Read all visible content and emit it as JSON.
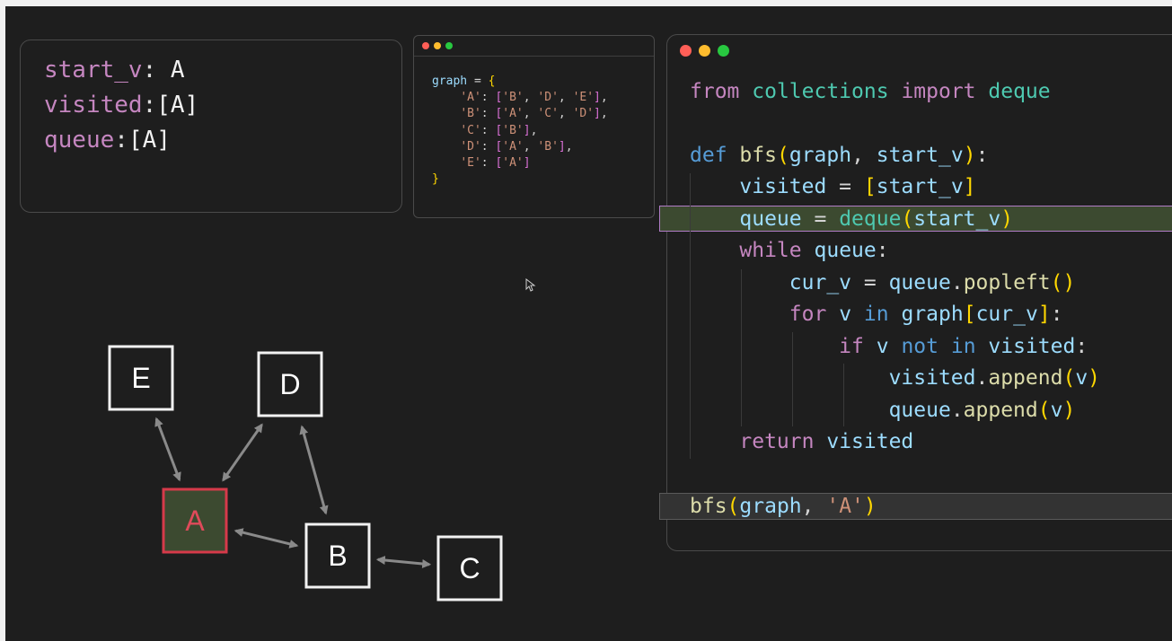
{
  "state": {
    "start_v": {
      "key": "start_v",
      "colon": ": ",
      "value": "A"
    },
    "visited": {
      "key": "visited",
      "colon": ":",
      "value": "[A]"
    },
    "queue": {
      "key": "queue",
      "colon": ":",
      "value": "[A]"
    }
  },
  "mini_code": {
    "lines": [
      [
        {
          "t": "graph",
          "c": "var"
        },
        {
          "t": " = ",
          "c": "pun"
        },
        {
          "t": "{",
          "c": "br"
        }
      ],
      [
        {
          "t": "    ",
          "c": "pun"
        },
        {
          "t": "'A'",
          "c": "str"
        },
        {
          "t": ": ",
          "c": "pun"
        },
        {
          "t": "[",
          "c": "br2"
        },
        {
          "t": "'B'",
          "c": "str"
        },
        {
          "t": ", ",
          "c": "pun"
        },
        {
          "t": "'D'",
          "c": "str"
        },
        {
          "t": ", ",
          "c": "pun"
        },
        {
          "t": "'E'",
          "c": "str"
        },
        {
          "t": "]",
          "c": "br2"
        },
        {
          "t": ",",
          "c": "pun"
        }
      ],
      [
        {
          "t": "    ",
          "c": "pun"
        },
        {
          "t": "'B'",
          "c": "str"
        },
        {
          "t": ": ",
          "c": "pun"
        },
        {
          "t": "[",
          "c": "br2"
        },
        {
          "t": "'A'",
          "c": "str"
        },
        {
          "t": ", ",
          "c": "pun"
        },
        {
          "t": "'C'",
          "c": "str"
        },
        {
          "t": ", ",
          "c": "pun"
        },
        {
          "t": "'D'",
          "c": "str"
        },
        {
          "t": "]",
          "c": "br2"
        },
        {
          "t": ",",
          "c": "pun"
        }
      ],
      [
        {
          "t": "    ",
          "c": "pun"
        },
        {
          "t": "'C'",
          "c": "str"
        },
        {
          "t": ": ",
          "c": "pun"
        },
        {
          "t": "[",
          "c": "br2"
        },
        {
          "t": "'B'",
          "c": "str"
        },
        {
          "t": "]",
          "c": "br2"
        },
        {
          "t": ",",
          "c": "pun"
        }
      ],
      [
        {
          "t": "    ",
          "c": "pun"
        },
        {
          "t": "'D'",
          "c": "str"
        },
        {
          "t": ": ",
          "c": "pun"
        },
        {
          "t": "[",
          "c": "br2"
        },
        {
          "t": "'A'",
          "c": "str"
        },
        {
          "t": ", ",
          "c": "pun"
        },
        {
          "t": "'B'",
          "c": "str"
        },
        {
          "t": "]",
          "c": "br2"
        },
        {
          "t": ",",
          "c": "pun"
        }
      ],
      [
        {
          "t": "    ",
          "c": "pun"
        },
        {
          "t": "'E'",
          "c": "str"
        },
        {
          "t": ": ",
          "c": "pun"
        },
        {
          "t": "[",
          "c": "br2"
        },
        {
          "t": "'A'",
          "c": "str"
        },
        {
          "t": "]",
          "c": "br2"
        }
      ],
      [
        {
          "t": "}",
          "c": "br"
        }
      ]
    ]
  },
  "code": {
    "lines": [
      [
        {
          "t": "from",
          "c": "kw"
        },
        {
          "t": " ",
          "c": "pun"
        },
        {
          "t": "collections",
          "c": "cls"
        },
        {
          "t": " ",
          "c": "pun"
        },
        {
          "t": "import",
          "c": "kw"
        },
        {
          "t": " ",
          "c": "pun"
        },
        {
          "t": "deque",
          "c": "cls"
        }
      ],
      [
        {
          "t": "def",
          "c": "kwb"
        },
        {
          "t": " ",
          "c": "pun"
        },
        {
          "t": "bfs",
          "c": "fn"
        },
        {
          "t": "(",
          "c": "br"
        },
        {
          "t": "graph",
          "c": "var"
        },
        {
          "t": ", ",
          "c": "pun"
        },
        {
          "t": "start_v",
          "c": "var"
        },
        {
          "t": ")",
          "c": "br"
        },
        {
          "t": ":",
          "c": "pun"
        }
      ],
      [
        {
          "t": "    ",
          "c": "pun"
        },
        {
          "t": "visited",
          "c": "var"
        },
        {
          "t": " = ",
          "c": "pun"
        },
        {
          "t": "[",
          "c": "br"
        },
        {
          "t": "start_v",
          "c": "var"
        },
        {
          "t": "]",
          "c": "br"
        }
      ],
      [
        {
          "t": "    ",
          "c": "pun"
        },
        {
          "t": "queue",
          "c": "var"
        },
        {
          "t": " = ",
          "c": "pun"
        },
        {
          "t": "deque",
          "c": "cls"
        },
        {
          "t": "(",
          "c": "br"
        },
        {
          "t": "start_v",
          "c": "var"
        },
        {
          "t": ")",
          "c": "br"
        }
      ],
      [
        {
          "t": "    ",
          "c": "pun"
        },
        {
          "t": "while",
          "c": "kw"
        },
        {
          "t": " ",
          "c": "pun"
        },
        {
          "t": "queue",
          "c": "var"
        },
        {
          "t": ":",
          "c": "pun"
        }
      ],
      [
        {
          "t": "        ",
          "c": "pun"
        },
        {
          "t": "cur_v",
          "c": "var"
        },
        {
          "t": " = ",
          "c": "pun"
        },
        {
          "t": "queue",
          "c": "var"
        },
        {
          "t": ".",
          "c": "pun"
        },
        {
          "t": "popleft",
          "c": "fn"
        },
        {
          "t": "()",
          "c": "br"
        }
      ],
      [
        {
          "t": "        ",
          "c": "pun"
        },
        {
          "t": "for",
          "c": "kw"
        },
        {
          "t": " ",
          "c": "pun"
        },
        {
          "t": "v",
          "c": "var"
        },
        {
          "t": " ",
          "c": "pun"
        },
        {
          "t": "in",
          "c": "kwb"
        },
        {
          "t": " ",
          "c": "pun"
        },
        {
          "t": "graph",
          "c": "var"
        },
        {
          "t": "[",
          "c": "br"
        },
        {
          "t": "cur_v",
          "c": "var"
        },
        {
          "t": "]",
          "c": "br"
        },
        {
          "t": ":",
          "c": "pun"
        }
      ],
      [
        {
          "t": "            ",
          "c": "pun"
        },
        {
          "t": "if",
          "c": "kw"
        },
        {
          "t": " ",
          "c": "pun"
        },
        {
          "t": "v",
          "c": "var"
        },
        {
          "t": " ",
          "c": "pun"
        },
        {
          "t": "not",
          "c": "kwb"
        },
        {
          "t": " ",
          "c": "pun"
        },
        {
          "t": "in",
          "c": "kwb"
        },
        {
          "t": " ",
          "c": "pun"
        },
        {
          "t": "visited",
          "c": "var"
        },
        {
          "t": ":",
          "c": "pun"
        }
      ],
      [
        {
          "t": "                ",
          "c": "pun"
        },
        {
          "t": "visited",
          "c": "var"
        },
        {
          "t": ".",
          "c": "pun"
        },
        {
          "t": "append",
          "c": "fn"
        },
        {
          "t": "(",
          "c": "br"
        },
        {
          "t": "v",
          "c": "var"
        },
        {
          "t": ")",
          "c": "br"
        }
      ],
      [
        {
          "t": "                ",
          "c": "pun"
        },
        {
          "t": "queue",
          "c": "var"
        },
        {
          "t": ".",
          "c": "pun"
        },
        {
          "t": "append",
          "c": "fn"
        },
        {
          "t": "(",
          "c": "br"
        },
        {
          "t": "v",
          "c": "var"
        },
        {
          "t": ")",
          "c": "br"
        }
      ],
      [
        {
          "t": "    ",
          "c": "pun"
        },
        {
          "t": "return",
          "c": "kw"
        },
        {
          "t": " ",
          "c": "pun"
        },
        {
          "t": "visited",
          "c": "var"
        }
      ],
      [
        {
          "t": "bfs",
          "c": "fn"
        },
        {
          "t": "(",
          "c": "br"
        },
        {
          "t": "graph",
          "c": "var"
        },
        {
          "t": ", ",
          "c": "pun"
        },
        {
          "t": "'A'",
          "c": "str"
        },
        {
          "t": ")",
          "c": "br"
        }
      ]
    ]
  },
  "graph": {
    "nodes": [
      {
        "id": "E",
        "label": "E",
        "state": "default"
      },
      {
        "id": "D",
        "label": "D",
        "state": "default"
      },
      {
        "id": "A",
        "label": "A",
        "state": "current"
      },
      {
        "id": "B",
        "label": "B",
        "state": "default"
      },
      {
        "id": "C",
        "label": "C",
        "state": "default"
      }
    ],
    "edges": [
      [
        "A",
        "E"
      ],
      [
        "A",
        "D"
      ],
      [
        "A",
        "B"
      ],
      [
        "B",
        "D"
      ],
      [
        "B",
        "C"
      ]
    ]
  },
  "colors": {
    "current_fill": "#3c4a30",
    "current_stroke": "#d63a4a",
    "current_text": "#e04a5a",
    "node_stroke": "#f2f2f2",
    "edge": "#8a8a8a",
    "active_line_bg": "#3c4a30",
    "active_line_border": "#b07cc6"
  }
}
